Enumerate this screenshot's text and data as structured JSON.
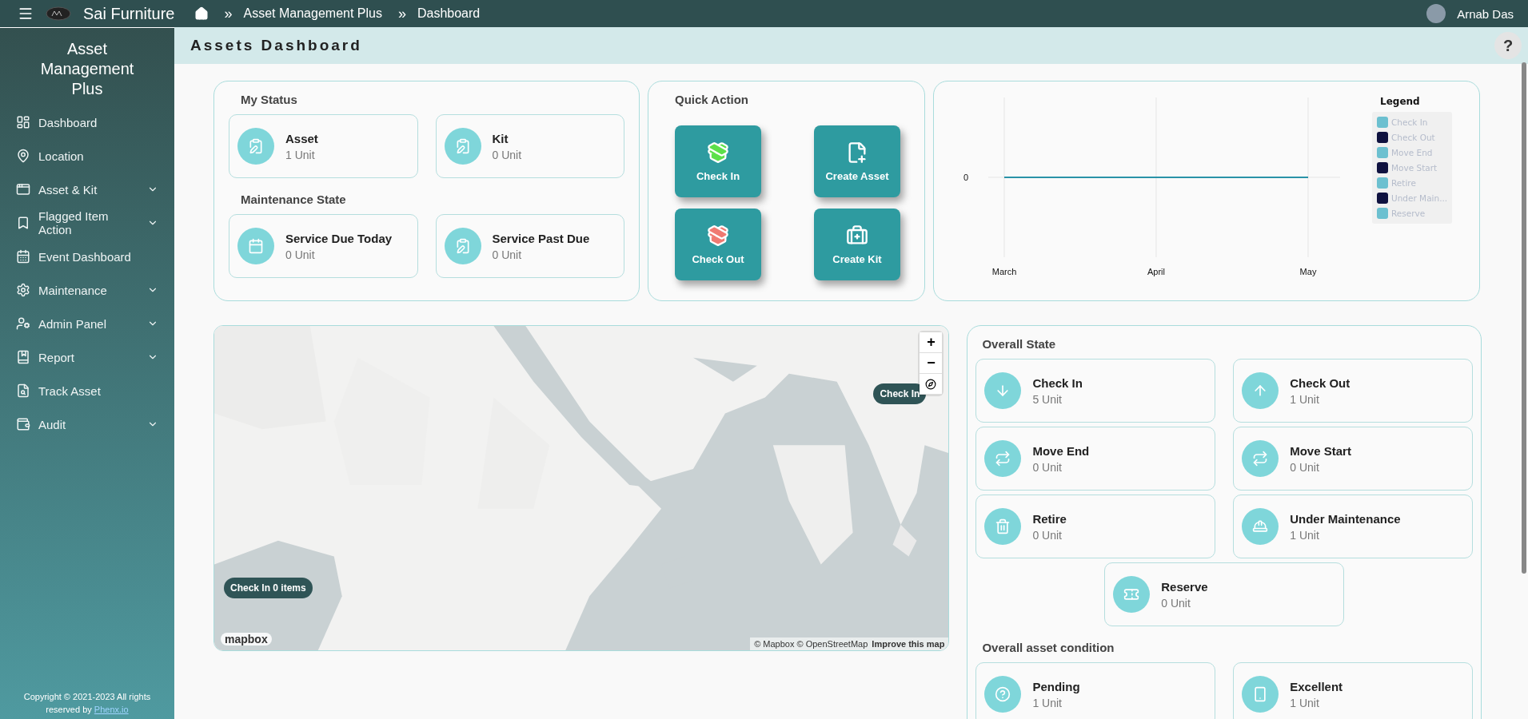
{
  "topbar": {
    "brand": "Sai Furniture",
    "separator": "»",
    "breadcrumb": [
      "Asset Management Plus",
      "Dashboard"
    ],
    "user": "Arnab Das"
  },
  "sidebar": {
    "title": "Asset Management Plus",
    "items": [
      {
        "label": "Dashboard",
        "expandable": false
      },
      {
        "label": "Location",
        "expandable": false
      },
      {
        "label": "Asset & Kit",
        "expandable": true
      },
      {
        "label": "Flagged Item Action",
        "expandable": true
      },
      {
        "label": "Event Dashboard",
        "expandable": false
      },
      {
        "label": "Maintenance",
        "expandable": true
      },
      {
        "label": "Admin Panel",
        "expandable": true
      },
      {
        "label": "Report",
        "expandable": true
      },
      {
        "label": "Track Asset",
        "expandable": false
      },
      {
        "label": "Audit",
        "expandable": true
      }
    ],
    "copyright": "Copyright © 2021-2023 All rights reserved by",
    "copyright_link": "Phenx.io"
  },
  "page_title": "Assets Dashboard",
  "help": "?",
  "my_status": {
    "title": "My Status",
    "tiles": [
      {
        "label": "Asset",
        "value": "1 Unit"
      },
      {
        "label": "Kit",
        "value": "0 Unit"
      }
    ]
  },
  "maintenance_state": {
    "title": "Maintenance State",
    "tiles": [
      {
        "label": "Service Due Today",
        "value": "0 Unit"
      },
      {
        "label": "Service Past Due",
        "value": "0 Unit"
      }
    ]
  },
  "quick_action": {
    "title": "Quick Action",
    "buttons": [
      {
        "label": "Check In"
      },
      {
        "label": "Create Asset"
      },
      {
        "label": "Check Out"
      },
      {
        "label": "Create Kit"
      }
    ]
  },
  "chart": {
    "legend_title": "Legend",
    "y_tick_label": "0",
    "x_labels": [
      "March",
      "April",
      "May"
    ],
    "legend": [
      {
        "name": "Check In",
        "color": "#6cc0d0"
      },
      {
        "name": "Check Out",
        "color": "#0f1240"
      },
      {
        "name": "Move End",
        "color": "#6cc0d0"
      },
      {
        "name": "Move Start",
        "color": "#0f1240"
      },
      {
        "name": "Retire",
        "color": "#6cc0d0"
      },
      {
        "name": "Under Main...",
        "color": "#0f1240"
      },
      {
        "name": "Reserve",
        "color": "#6cc0d0"
      }
    ]
  },
  "map": {
    "kind": "picture",
    "markers": [
      {
        "label": "Check In 0 items"
      },
      {
        "label": "Check In"
      }
    ],
    "zoom_in": "+",
    "zoom_out": "−",
    "logo": "mapbox",
    "attribution": "© Mapbox © OpenStreetMap",
    "improve_link": "Improve this map"
  },
  "overall_state": {
    "title": "Overall State",
    "tiles": [
      {
        "label": "Check In",
        "value": "5 Unit"
      },
      {
        "label": "Check Out",
        "value": "1 Unit"
      },
      {
        "label": "Move End",
        "value": "0 Unit"
      },
      {
        "label": "Move Start",
        "value": "0 Unit"
      },
      {
        "label": "Retire",
        "value": "0 Unit"
      },
      {
        "label": "Under Maintenance",
        "value": "1 Unit"
      },
      {
        "label": "Reserve",
        "value": "0 Unit"
      }
    ]
  },
  "asset_condition": {
    "title": "Overall asset condition",
    "tiles": [
      {
        "label": "Pending",
        "value": "1 Unit"
      },
      {
        "label": "Excellent",
        "value": "1 Unit"
      }
    ]
  }
}
